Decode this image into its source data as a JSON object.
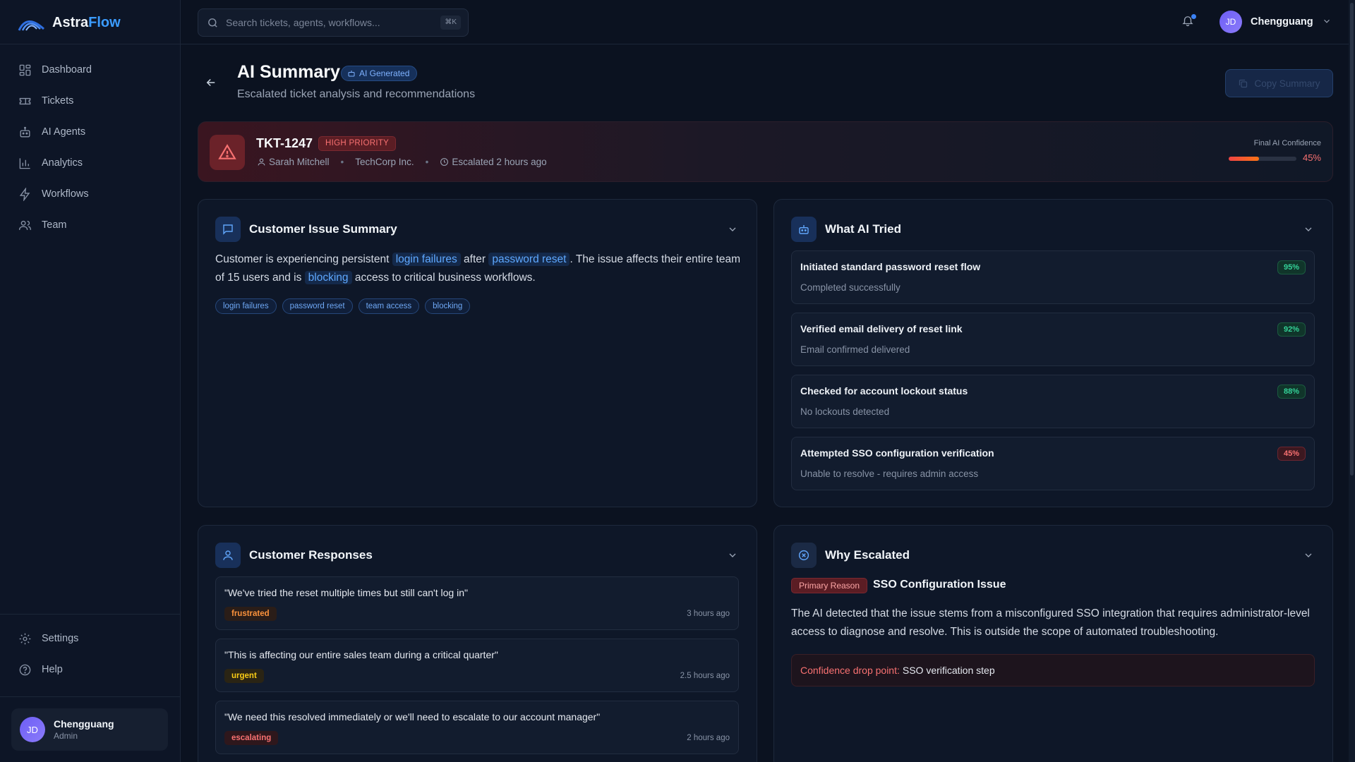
{
  "brand": {
    "name_main": "Astra",
    "name_accent": "Flow"
  },
  "sidebar": {
    "items": [
      {
        "label": "Dashboard",
        "icon": "grid-icon"
      },
      {
        "label": "Tickets",
        "icon": "ticket-icon"
      },
      {
        "label": "AI Agents",
        "icon": "robot-icon"
      },
      {
        "label": "Analytics",
        "icon": "bar-chart-icon"
      },
      {
        "label": "Workflows",
        "icon": "lightning-icon"
      },
      {
        "label": "Team",
        "icon": "users-icon"
      }
    ],
    "bottom_items": [
      {
        "label": "Settings",
        "icon": "gear-icon"
      },
      {
        "label": "Help",
        "icon": "help-icon"
      }
    ],
    "user": {
      "initials": "JD",
      "name": "Chengguang",
      "role": "Admin"
    }
  },
  "header": {
    "search_placeholder": "Search tickets, agents, workflows...",
    "search_shortcut": "⌘K",
    "user": {
      "initials": "JD",
      "name": "Chengguang"
    }
  },
  "page": {
    "title": "AI Summary",
    "badge": "AI Generated",
    "subtitle": "Escalated ticket analysis and recommendations",
    "copy_button": "Copy Summary"
  },
  "ticket": {
    "id": "TKT-1247",
    "priority": "HIGH PRIORITY",
    "customer": "Sarah Mitchell",
    "company": "TechCorp Inc.",
    "escalated": "Escalated 2 hours ago",
    "confidence_label": "Final AI Confidence",
    "confidence_value": "45%",
    "confidence_fraction": 0.45
  },
  "issue_summary": {
    "title": "Customer Issue Summary",
    "text_1": "Customer is experiencing persistent",
    "hl_1": "login failures",
    "text_2": "after",
    "hl_2": "password reset",
    "text_3": ". The issue affects their entire team of 15 users and is",
    "hl_3": "blocking",
    "text_4": "access to critical business workflows.",
    "tags": [
      "login failures",
      "password reset",
      "team access",
      "blocking"
    ]
  },
  "ai_tried": {
    "title": "What AI Tried",
    "steps": [
      {
        "title": "Initiated standard password reset flow",
        "result": "Completed successfully",
        "confidence": "95%",
        "status": "good"
      },
      {
        "title": "Verified email delivery of reset link",
        "result": "Email confirmed delivered",
        "confidence": "92%",
        "status": "good"
      },
      {
        "title": "Checked for account lockout status",
        "result": "No lockouts detected",
        "confidence": "88%",
        "status": "good"
      },
      {
        "title": "Attempted SSO configuration verification",
        "result": "Unable to resolve - requires admin access",
        "confidence": "45%",
        "status": "bad"
      }
    ]
  },
  "responses": {
    "title": "Customer Responses",
    "items": [
      {
        "quote": "\"We've tried the reset multiple times but still can't log in\"",
        "sentiment": "frustrated",
        "time": "3 hours ago"
      },
      {
        "quote": "\"This is affecting our entire sales team during a critical quarter\"",
        "sentiment": "urgent",
        "time": "2.5 hours ago"
      },
      {
        "quote": "\"We need this resolved immediately or we'll need to escalate to our account manager\"",
        "sentiment": "escalating",
        "time": "2 hours ago"
      }
    ]
  },
  "escalation": {
    "title": "Why Escalated",
    "reason_badge": "Primary Reason",
    "reason_title": "SSO Configuration Issue",
    "description": "The AI detected that the issue stems from a misconfigured SSO integration that requires administrator-level access to diagnose and resolve. This is outside the scope of automated troubleshooting.",
    "drop_label": "Confidence drop point:",
    "drop_value": "SSO verification step"
  },
  "colors": {
    "accent": "#3b9cff",
    "danger": "#f87171",
    "success": "#34d399",
    "background": "#0b1220"
  }
}
